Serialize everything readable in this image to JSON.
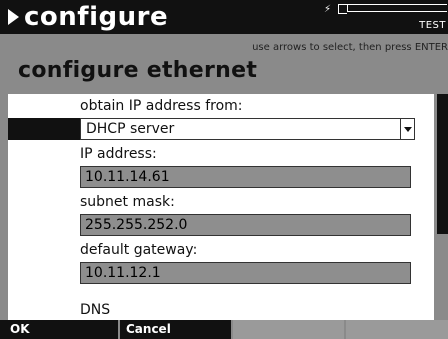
{
  "header": {
    "title": "configure",
    "mode": "TEST",
    "plug_icon": "plug-icon",
    "battery_icon": "battery-icon"
  },
  "hint": "use arrows to select, then press ENTER",
  "screen_title": "configure ethernet",
  "form": {
    "obtain_label": "obtain IP address from:",
    "obtain_value": "DHCP server",
    "ip_label": "IP address:",
    "ip_value": "10.11.14.61",
    "subnet_label": "subnet mask:",
    "subnet_value": "255.255.252.0",
    "gateway_label": "default gateway:",
    "gateway_value": "10.11.12.1",
    "dns_label": "DNS"
  },
  "softkeys": {
    "ok": "OK",
    "cancel": "Cancel"
  },
  "colors": {
    "titlebar": "#111111",
    "background": "#8a8a8a",
    "panel": "#ffffff",
    "input_fill": "#8e8e8e"
  }
}
